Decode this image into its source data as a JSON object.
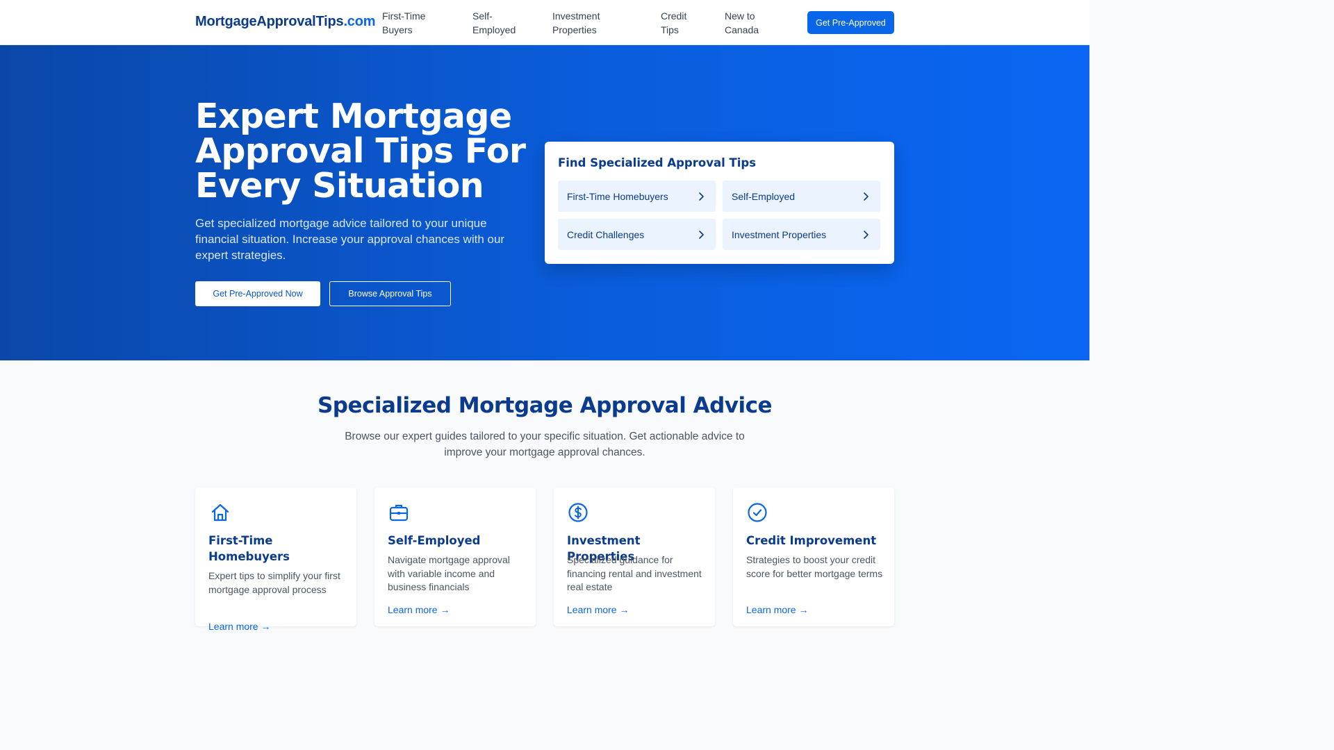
{
  "header": {
    "logo_main": "MortgageApprovalTips",
    "logo_tld": ".com",
    "nav": [
      "First-Time Buyers",
      "Self-Employed",
      "Investment Properties",
      "Credit Tips",
      "New to Canada"
    ],
    "cta": "Get Pre-Approved"
  },
  "hero": {
    "title": "Expert Mortgage Approval Tips For Every Situation",
    "subtitle": "Get specialized mortgage advice tailored to your unique financial situation. Increase your approval chances with our expert strategies.",
    "primary_button": "Get Pre-Approved Now",
    "secondary_button": "Browse Approval Tips",
    "finder": {
      "title": "Find Specialized Approval Tips",
      "options": [
        "First-Time Homebuyers",
        "Self-Employed",
        "Credit Challenges",
        "Investment Properties"
      ]
    }
  },
  "section": {
    "title": "Specialized Mortgage Approval Advice",
    "subtitle": "Browse our expert guides tailored to your specific situation. Get actionable advice to improve your mortgage approval chances.",
    "cards": [
      {
        "icon": "home-icon",
        "title": "First-Time Homebuyers",
        "desc": "Expert tips to simplify your first mortgage approval process",
        "link": "Learn more →"
      },
      {
        "icon": "briefcase-icon",
        "title": "Self-Employed",
        "desc": "Navigate mortgage approval with variable income and business financials",
        "link": "Learn more →"
      },
      {
        "icon": "dollar-circle-icon",
        "title": "Investment Properties",
        "desc": "Specialized guidance for financing rental and investment real estate",
        "link": "Learn more →"
      },
      {
        "icon": "check-circle-icon",
        "title": "Credit Improvement",
        "desc": "Strategies to boost your credit score for better mortgage terms",
        "link": "Learn more →"
      }
    ]
  },
  "colors": {
    "brand_dark": "#0b3b8c",
    "accent": "#0a66e8",
    "option_bg": "#eaf3fe"
  }
}
